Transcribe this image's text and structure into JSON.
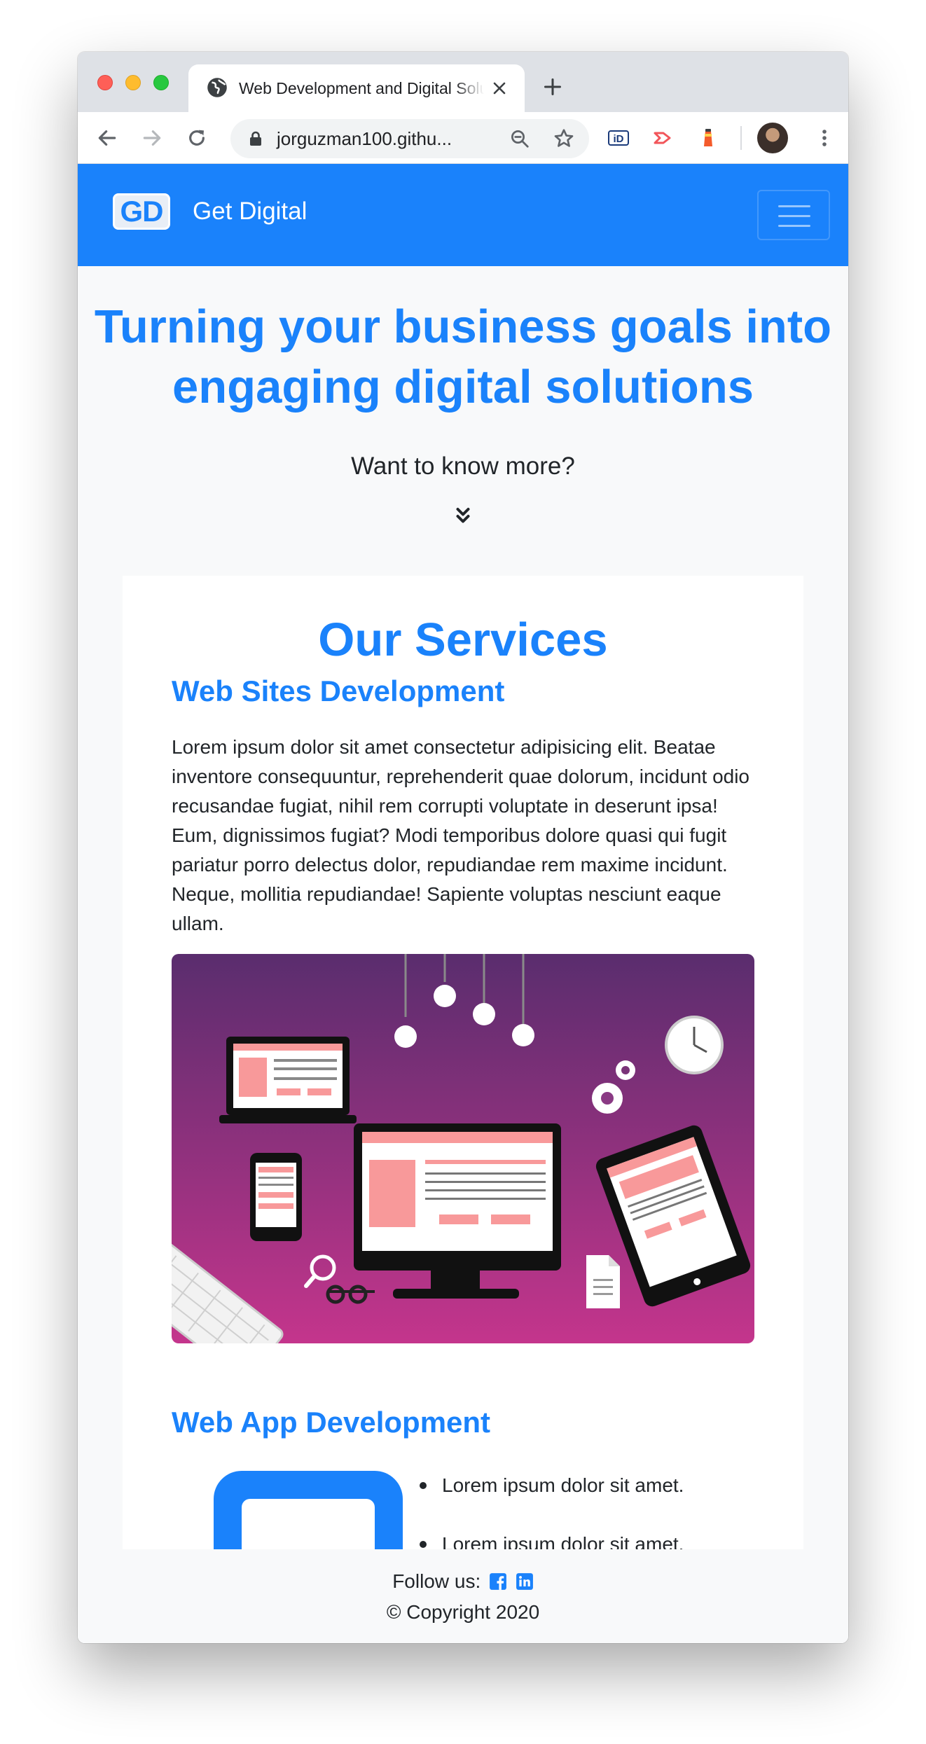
{
  "browser": {
    "tab_title": "Web Development and Digital Solutions",
    "url": "jorguzman100.githu..."
  },
  "navbar": {
    "logo_text": "GD",
    "brand_name": "Get Digital"
  },
  "hero": {
    "title_line1": "Turning your business goals into",
    "title_line2": "engaging digital solutions",
    "subtitle": "Want to know more?"
  },
  "services": {
    "title": "Our Services",
    "web_sites": {
      "heading": "Web Sites Development",
      "paragraph": "Lorem ipsum dolor sit amet consectetur adipisicing elit. Beatae inventore consequuntur, reprehenderit quae dolorum, incidunt odio recusandae fugiat, nihil rem corrupti voluptate in deserunt ipsa! Eum, dignissimos fugiat? Modi temporibus dolore quasi qui fugit pariatur porro delectus dolor, repudiandae rem maxime incidunt. Neque, mollitia repudiandae! Sapiente voluptas nesciunt eaque ullam."
    },
    "web_apps": {
      "heading": "Web App Development",
      "bullets": [
        "Lorem ipsum dolor sit amet.",
        "Lorem ipsum dolor sit amet."
      ]
    }
  },
  "footer": {
    "follow_label": "Follow us:",
    "copyright": "© Copyright 2020"
  },
  "colors": {
    "brand_blue": "#1a82fb",
    "illustration_top": "#5a2d6e",
    "illustration_bottom": "#c4358c",
    "screen_accent": "#f8999a"
  },
  "icons": [
    "globe-icon",
    "close-icon",
    "plus-icon",
    "back-icon",
    "forward-icon",
    "reload-icon",
    "lock-icon",
    "zoom-icon",
    "star-icon",
    "extension-icon",
    "menu-dots-icon",
    "chevrons-down-icon",
    "facebook-icon",
    "linkedin-icon"
  ]
}
